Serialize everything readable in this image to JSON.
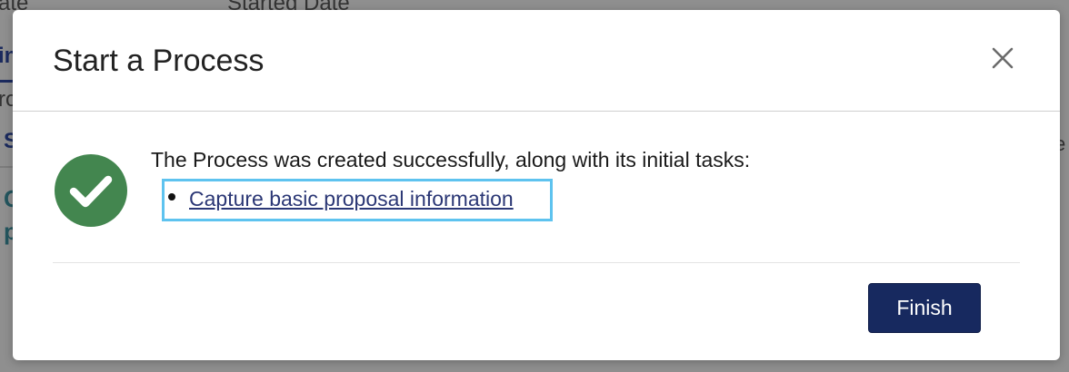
{
  "background": {
    "col1_fragment": "ate",
    "col2_fragment": "Started Date",
    "tab_fragment": "in",
    "row_fragment": "ro",
    "s_fragment": "S",
    "e_fragment": "e",
    "c_fragment": "C",
    "p_fragment": "p"
  },
  "dialog": {
    "title": "Start a Process",
    "close_icon": "close-icon",
    "success_icon": "check-circle-icon",
    "success_color": "#43864f",
    "message": "The Process was created successfully, along with its initial tasks:",
    "tasks": [
      {
        "label": "Capture basic proposal information"
      }
    ],
    "finish_label": "Finish",
    "finish_color": "#17295f",
    "highlight_color": "#5ec3ef"
  }
}
